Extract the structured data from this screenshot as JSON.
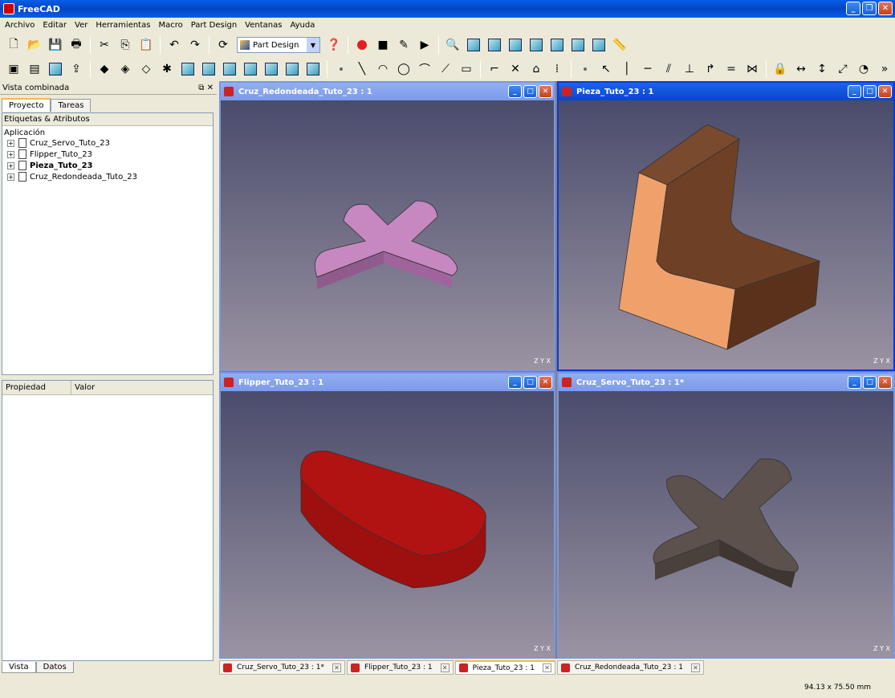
{
  "app": {
    "title": "FreeCAD"
  },
  "menu": [
    "Archivo",
    "Editar",
    "Ver",
    "Herramientas",
    "Macro",
    "Part Design",
    "Ventanas",
    "Ayuda"
  ],
  "toolbar": {
    "workbench": "Part Design",
    "overflow": "»"
  },
  "combo_view": {
    "title": "Vista combinada",
    "tabs": [
      "Proyecto",
      "Tareas"
    ],
    "tree_header": "Etiquetas & Atributos",
    "tree_root": "Aplicación",
    "documents": [
      "Cruz_Servo_Tuto_23",
      "Flipper_Tuto_23",
      "Pieza_Tuto_23",
      "Cruz_Redondeada_Tuto_23"
    ],
    "property_headers": [
      "Propiedad",
      "Valor"
    ],
    "bottom_tabs": [
      "Vista",
      "Datos"
    ]
  },
  "subwindows": {
    "tl": {
      "title": "Cruz_Redondeada_Tuto_23 : 1",
      "shape": "pink-cross"
    },
    "tr": {
      "title": "Pieza_Tuto_23 : 1",
      "shape": "l-bracket"
    },
    "bl": {
      "title": "Flipper_Tuto_23 : 1",
      "shape": "red-flipper"
    },
    "br": {
      "title": "Cruz_Servo_Tuto_23 : 1*",
      "shape": "servo-cross"
    }
  },
  "doc_tabs": [
    "Cruz_Servo_Tuto_23 : 1*",
    "Flipper_Tuto_23 : 1",
    "Pieza_Tuto_23 : 1",
    "Cruz_Redondeada_Tuto_23 : 1"
  ],
  "axis_label": "Z Y X",
  "status": {
    "dimensions": "94.13 x 75.50 mm"
  },
  "colors": {
    "pink": "#c787c1",
    "brown": "#7a4a2e",
    "red": "#b11212",
    "gray": "#5c514c",
    "title_active": "#0a46d0"
  }
}
